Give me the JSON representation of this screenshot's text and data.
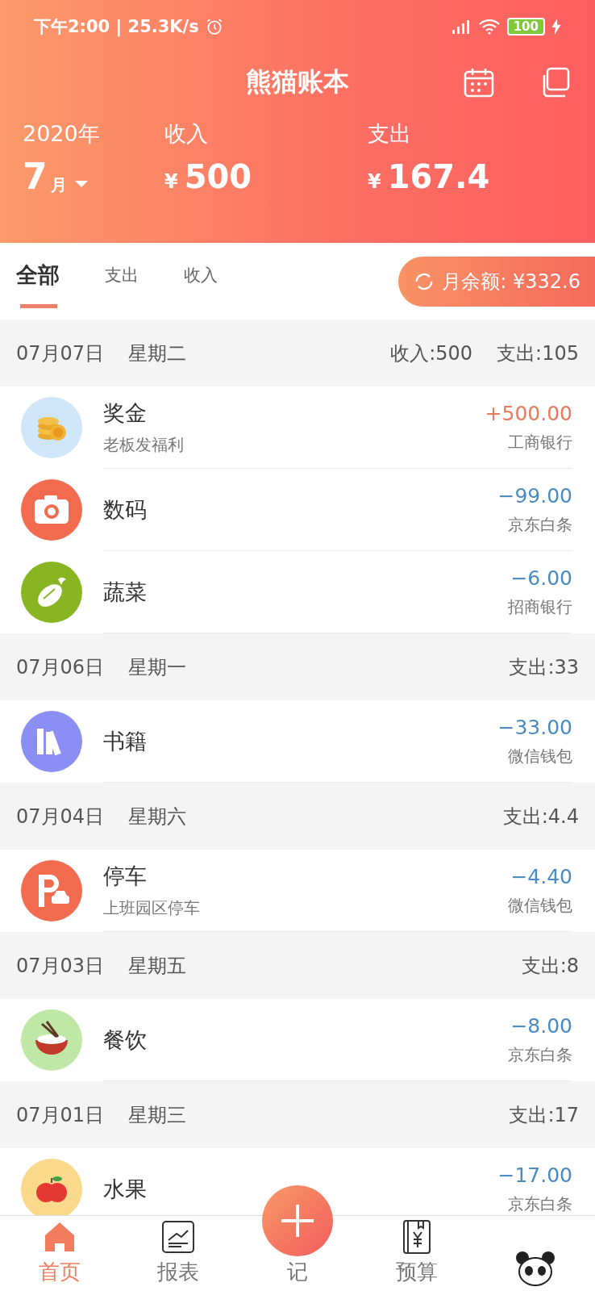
{
  "status_bar": {
    "time": "下午2:00 | 25.3K/s",
    "battery": "100"
  },
  "header": {
    "title": "熊猫账本",
    "year": "2020年",
    "month": "7",
    "month_unit": "月",
    "summary": [
      {
        "label": "收入",
        "currency": "¥",
        "value": "500"
      },
      {
        "label": "支出",
        "currency": "¥",
        "value": "167.4"
      }
    ]
  },
  "filter_tabs": [
    {
      "label": "全部",
      "selected": true
    },
    {
      "label": "支出",
      "selected": false
    },
    {
      "label": "收入",
      "selected": false
    }
  ],
  "balance": "月余额: ¥332.6",
  "days": [
    {
      "date": "07月07日",
      "weekday": "星期二",
      "totals": [
        "收入:500",
        "支出:105"
      ],
      "items": [
        {
          "kind": "coins",
          "category": "奖金",
          "note": "老板发福利",
          "amount": "+500.00",
          "account": "工商银行",
          "color": "#e8795e"
        },
        {
          "kind": "camera",
          "category": "数码",
          "amount": "−99.00",
          "account": "京东白条",
          "color": "#4a8bc2"
        },
        {
          "kind": "vegetable",
          "category": "蔬菜",
          "amount": "−6.00",
          "account": "招商银行",
          "color": "#4a8bc2"
        }
      ]
    },
    {
      "date": "07月06日",
      "weekday": "星期一",
      "totals": [
        "支出:33"
      ],
      "items": [
        {
          "kind": "books",
          "category": "书籍",
          "amount": "−33.00",
          "account": "微信钱包",
          "color": "#4a8bc2"
        }
      ]
    },
    {
      "date": "07月04日",
      "weekday": "星期六",
      "totals": [
        "支出:4.4"
      ],
      "items": [
        {
          "kind": "parking",
          "category": "停车",
          "note": "上班园区停车",
          "amount": "−4.40",
          "account": "微信钱包",
          "color": "#4a8bc2"
        }
      ]
    },
    {
      "date": "07月03日",
      "weekday": "星期五",
      "totals": [
        "支出:8"
      ],
      "items": [
        {
          "kind": "food",
          "category": "餐饮",
          "amount": "−8.00",
          "account": "京东白条",
          "color": "#4a8bc2"
        }
      ]
    },
    {
      "date": "07月01日",
      "weekday": "星期三",
      "totals": [
        "支出:17"
      ],
      "items": [
        {
          "kind": "fruit",
          "category": "水果",
          "amount": "−17.00",
          "account": "京东白条",
          "color": "#4a8bc2"
        }
      ]
    }
  ],
  "nav": [
    {
      "kind": "home",
      "label": "首页",
      "selected": true
    },
    {
      "kind": "report",
      "label": "报表",
      "selected": false
    },
    {
      "kind": "add",
      "label": "记",
      "selected": false
    },
    {
      "kind": "budget",
      "label": "预算",
      "selected": false
    },
    {
      "kind": "profile",
      "selected": false
    }
  ]
}
